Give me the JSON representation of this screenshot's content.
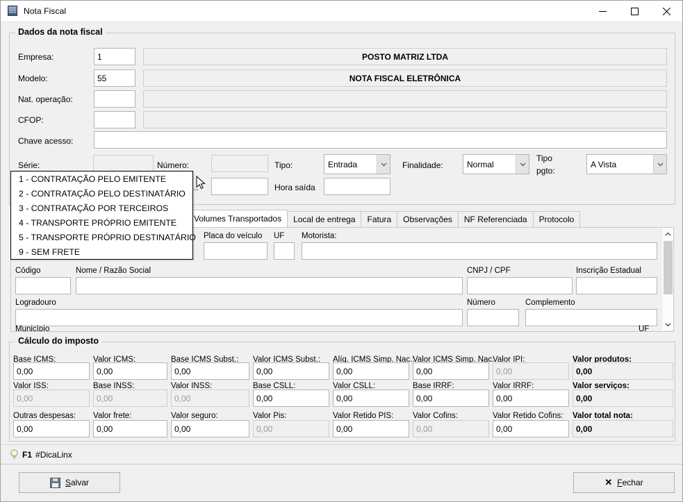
{
  "window": {
    "title": "Nota Fiscal",
    "icon": "nota-fiscal-icon",
    "minimize": "—",
    "maximize": "□",
    "close": "✕"
  },
  "nota_group": {
    "title": "Dados da nota fiscal",
    "rows": [
      {
        "label": "Empresa:",
        "code": "1",
        "description": "POSTO MATRIZ LTDA"
      },
      {
        "label": "Modelo:",
        "code": "55",
        "description": "NOTA FISCAL ELETRÔNICA"
      },
      {
        "label": "Nat. operação:",
        "code": "",
        "description": ""
      },
      {
        "label": "CFOP:",
        "code": "",
        "description": ""
      }
    ],
    "chave": {
      "label": "Chave acesso:",
      "value": ""
    },
    "serie": {
      "label": "Série:",
      "value": ""
    },
    "numero": {
      "label": "Número:",
      "value": ""
    },
    "tipo": {
      "label": "Tipo:",
      "value": "Entrada"
    },
    "finalidade": {
      "label": "Finalidade:",
      "value": "Normal"
    },
    "tipo_pgto": {
      "label": "Tipo pgto:",
      "label_line1": "Tipo",
      "label_line2": "pgto:",
      "value": "A Vista"
    },
    "data_saida": {
      "label": ".:",
      "value": ""
    },
    "hora_saida": {
      "label": "Hora saída",
      "value": ""
    }
  },
  "frete_dropdown": {
    "open": true,
    "options": [
      "1 - CONTRATAÇÃO PELO EMITENTE",
      "2 - CONTRATAÇÃO PELO DESTINATÁRIO",
      "3 - CONTRATAÇÃO POR TERCEIROS",
      "4 - TRANSPORTE PRÓPRIO EMITENTE",
      "5 - TRANSPORTE PRÓPRIO DESTINATÁRIO",
      "9 - SEM FRETE"
    ]
  },
  "tabs": [
    {
      "label": "r / Volumes Transportados",
      "active": true
    },
    {
      "label": "Local de entrega",
      "active": false
    },
    {
      "label": "Fatura",
      "active": false
    },
    {
      "label": "Observações",
      "active": false
    },
    {
      "label": "NF Referenciada",
      "active": false
    },
    {
      "label": "Protocolo",
      "active": false
    }
  ],
  "transporte": {
    "placa": {
      "label": "Placa do veículo",
      "value": ""
    },
    "uf": {
      "label": "UF",
      "value": ""
    },
    "motorista": {
      "label": "Motorista:",
      "value": ""
    },
    "codigo": {
      "label": "Código",
      "value": ""
    },
    "nome": {
      "label": "Nome / Razão Social",
      "value": ""
    },
    "cnpj": {
      "label": "CNPJ / CPF",
      "value": ""
    },
    "ie": {
      "label": "Inscrição Estadual",
      "value": ""
    },
    "logradouro": {
      "label": "Logradouro",
      "value": ""
    },
    "numero": {
      "label": "Número",
      "value": ""
    },
    "complemento": {
      "label": "Complemento",
      "value": ""
    },
    "municipio": {
      "label": "Município",
      "value": ""
    },
    "uf2": {
      "label": "UF",
      "value": ""
    }
  },
  "imposto": {
    "title": "Cálculo do imposto",
    "fields": [
      {
        "label": "Base ICMS:",
        "value": "0,00",
        "state": "enabled",
        "bold": false
      },
      {
        "label": "Valor ICMS:",
        "value": "0,00",
        "state": "enabled",
        "bold": false
      },
      {
        "label": "Base ICMS Subst.:",
        "value": "0,00",
        "state": "enabled",
        "bold": false
      },
      {
        "label": "Valor ICMS Subst.:",
        "value": "0,00",
        "state": "enabled",
        "bold": false
      },
      {
        "label": "Alíq. ICMS Simp. Nac.:",
        "value": "0,00",
        "state": "enabled",
        "bold": false
      },
      {
        "label": "Valor ICMS Simp. Nac.",
        "value": "0,00",
        "state": "enabled",
        "bold": false
      },
      {
        "label": "Valor IPI:",
        "value": "0,00",
        "state": "disabled",
        "bold": false
      },
      {
        "label": "Valor produtos:",
        "value": "0,00",
        "state": "readonly",
        "bold": true
      },
      {
        "label": "Valor ISS:",
        "value": "0,00",
        "state": "disabled",
        "bold": false
      },
      {
        "label": "Base INSS:",
        "value": "0,00",
        "state": "disabled",
        "bold": false
      },
      {
        "label": "Valor INSS:",
        "value": "0,00",
        "state": "disabled",
        "bold": false
      },
      {
        "label": "Base CSLL:",
        "value": "0,00",
        "state": "enabled",
        "bold": false
      },
      {
        "label": "Valor CSLL:",
        "value": "0,00",
        "state": "enabled",
        "bold": false
      },
      {
        "label": "Base IRRF:",
        "value": "0,00",
        "state": "enabled",
        "bold": false
      },
      {
        "label": "Valor IRRF:",
        "value": "0,00",
        "state": "enabled",
        "bold": false
      },
      {
        "label": "Valor serviços:",
        "value": "0,00",
        "state": "readonly",
        "bold": true
      },
      {
        "label": "Outras despesas:",
        "value": "0,00",
        "state": "enabled",
        "bold": false
      },
      {
        "label": "Valor frete:",
        "value": "0,00",
        "state": "enabled",
        "bold": false
      },
      {
        "label": "Valor seguro:",
        "value": "0,00",
        "state": "enabled",
        "bold": false
      },
      {
        "label": "Valor Pis:",
        "value": "0,00",
        "state": "disabled",
        "bold": false
      },
      {
        "label": "Valor Retido PIS:",
        "value": "0,00",
        "state": "enabled",
        "bold": false
      },
      {
        "label": "Valor Cofins:",
        "value": "0,00",
        "state": "disabled",
        "bold": false
      },
      {
        "label": "Valor Retido Cofins:",
        "value": "0,00",
        "state": "enabled",
        "bold": false
      },
      {
        "label": "Valor total nota:",
        "value": "0,00",
        "state": "readonly",
        "bold": true
      }
    ]
  },
  "hint": {
    "key": "F1",
    "text": "#DicaLinx"
  },
  "buttons": {
    "salvar": {
      "accel": "S",
      "rest": "alvar",
      "icon": "floppy-disk-icon"
    },
    "fechar": {
      "accel": "F",
      "rest": "echar",
      "icon": "x-icon"
    }
  },
  "colors": {
    "window_bg": "#f0f0f0",
    "titlebar_bg": "#ffffff",
    "field_border": "#b4b4b4",
    "disabled_text": "#9a9a9a",
    "tab_active_bg": "#ffffff"
  }
}
